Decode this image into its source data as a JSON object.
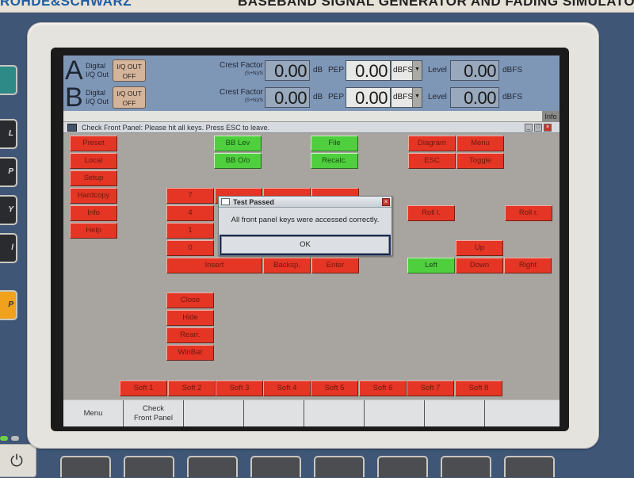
{
  "device": {
    "brand_partial": "ROHDE&SCHWARZ",
    "model_partial": "BASEBAND SIGNAL GENERATOR AND FADING SIMULATOR"
  },
  "header": {
    "paths": [
      {
        "letter": "A",
        "label_line1": "Digital",
        "label_line2": "I/Q Out",
        "iq_button_line1": "I/Q OUT",
        "iq_button_line2": "OFF",
        "crest_label": "Crest Factor",
        "crest_sub": "(S+N)/S",
        "crest_value": "0.00",
        "crest_unit": "dB",
        "pep_label": "PEP",
        "pep_value": "0.00",
        "pep_unit": "dBFS",
        "level_label": "Level",
        "level_value": "0.00",
        "level_unit": "dBFS"
      },
      {
        "letter": "B",
        "label_line1": "Digital",
        "label_line2": "I/Q Out",
        "iq_button_line1": "I/Q OUT",
        "iq_button_line2": "OFF",
        "crest_label": "Crest Factor",
        "crest_sub": "(S+N)/S",
        "crest_value": "0.00",
        "crest_unit": "dB",
        "pep_label": "PEP",
        "pep_value": "0.00",
        "pep_unit": "dBFS",
        "level_label": "Level",
        "level_value": "0.00",
        "level_unit": "dBFS"
      }
    ],
    "info_button": "Info"
  },
  "window": {
    "title": "Check Front Panel: Please hit all keys. Press ESC to leave.",
    "minimize": "_",
    "restore": "□",
    "close": "×"
  },
  "keys": {
    "left_column": [
      "Preset",
      "Local",
      "Setup",
      "Hardcopy",
      "Info",
      "Help"
    ],
    "bb": [
      "BB Lev",
      "BB O/o"
    ],
    "file": [
      "File",
      "Recalc."
    ],
    "top_right": [
      "Diagram",
      "Menu",
      "ESC",
      "Toggle"
    ],
    "numpad": [
      "7",
      "4",
      "1",
      "0"
    ],
    "edit": [
      "Insert",
      "Backsp.",
      "Enter"
    ],
    "roll": [
      "Roll l.",
      "Roll r."
    ],
    "nav": [
      "Up",
      "Left",
      "Down",
      "Right"
    ],
    "window_keys": [
      "Close",
      "Hide",
      "Rearr.",
      "WinBar"
    ],
    "softkeys": [
      "Soft 1",
      "Soft 2",
      "Soft 3",
      "Soft 4",
      "Soft 5",
      "Soft 6",
      "Soft 7",
      "Soft 8"
    ]
  },
  "colors": {
    "key_not_pressed": "#e43525",
    "key_pressed": "#4fcf3e"
  },
  "dialog": {
    "title": "Test Passed",
    "message": "All front panel keys were accessed correctly.",
    "ok_label": "OK",
    "close": "×"
  },
  "softbar": {
    "cells": [
      "Menu",
      "Check\nFront Panel",
      "",
      "",
      "",
      "",
      "",
      ""
    ]
  }
}
